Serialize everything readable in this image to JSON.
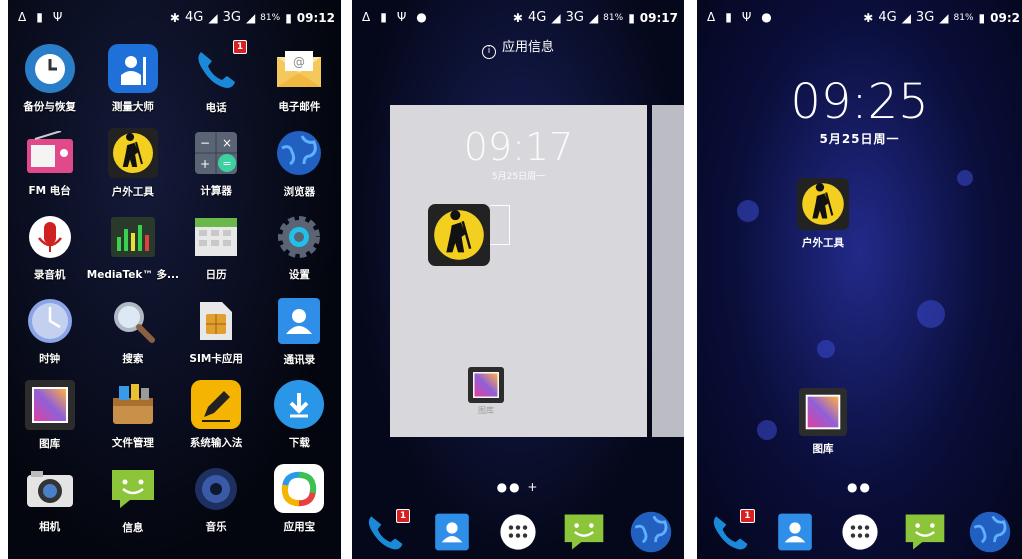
{
  "screens": [
    {
      "status": {
        "network": "4G",
        "network2": "3G",
        "battery": "81%",
        "time": "09:12"
      },
      "apps": [
        {
          "label": "备份与恢复",
          "icon": "clock-backup-icon"
        },
        {
          "label": "测量大师",
          "icon": "surveyor-icon"
        },
        {
          "label": "电话",
          "icon": "phone-icon",
          "badge": "1"
        },
        {
          "label": "电子邮件",
          "icon": "email-icon"
        },
        {
          "label": "FM 电台",
          "icon": "radio-icon"
        },
        {
          "label": "户外工具",
          "icon": "hiker-icon"
        },
        {
          "label": "计算器",
          "icon": "calculator-icon"
        },
        {
          "label": "浏览器",
          "icon": "globe-icon"
        },
        {
          "label": "录音机",
          "icon": "microphone-icon"
        },
        {
          "label": "MediaTek™ 多...",
          "icon": "equalizer-icon"
        },
        {
          "label": "日历",
          "icon": "calendar-icon"
        },
        {
          "label": "设置",
          "icon": "gear-icon"
        },
        {
          "label": "时钟",
          "icon": "clock-icon"
        },
        {
          "label": "搜索",
          "icon": "magnifier-icon"
        },
        {
          "label": "SIM卡应用",
          "icon": "sim-card-icon"
        },
        {
          "label": "通讯录",
          "icon": "contacts-icon"
        },
        {
          "label": "图库",
          "icon": "gallery-icon"
        },
        {
          "label": "文件管理",
          "icon": "toolbox-icon"
        },
        {
          "label": "系统输入法",
          "icon": "pencil-icon"
        },
        {
          "label": "下载",
          "icon": "download-icon"
        },
        {
          "label": "相机",
          "icon": "camera-icon"
        },
        {
          "label": "信息",
          "icon": "messaging-icon"
        },
        {
          "label": "音乐",
          "icon": "speaker-icon"
        },
        {
          "label": "应用宝",
          "icon": "app-store-icon"
        }
      ]
    },
    {
      "status": {
        "network": "4G",
        "network2": "3G",
        "battery": "81%",
        "time": "09:17"
      },
      "header": "应用信息",
      "preview_clock": "09:17",
      "preview_date": "5月25日周一",
      "preview_gallery_label": "图库",
      "page_dots": "●● +"
    },
    {
      "status": {
        "network": "4G",
        "network2": "3G",
        "battery": "81%",
        "time": "09:2"
      },
      "clock": "09:25",
      "date": "5月25日周一",
      "home_apps": [
        {
          "label": "户外工具",
          "icon": "hiker-icon"
        },
        {
          "label": "图库",
          "icon": "gallery-icon"
        }
      ],
      "page_dots": "●●"
    }
  ],
  "dock": [
    {
      "icon": "phone-icon",
      "badge": "1"
    },
    {
      "icon": "contacts-icon"
    },
    {
      "icon": "app-drawer-icon"
    },
    {
      "icon": "messaging-icon"
    },
    {
      "icon": "globe-icon"
    }
  ],
  "colors": {
    "phone": "#1a8ad8",
    "contacts": "#2e8ee8",
    "messaging": "#8cc43a",
    "hiker_yellow": "#f3d020",
    "download": "#2a96e8",
    "pencil": "#f5b400",
    "badge": "#d82020"
  }
}
